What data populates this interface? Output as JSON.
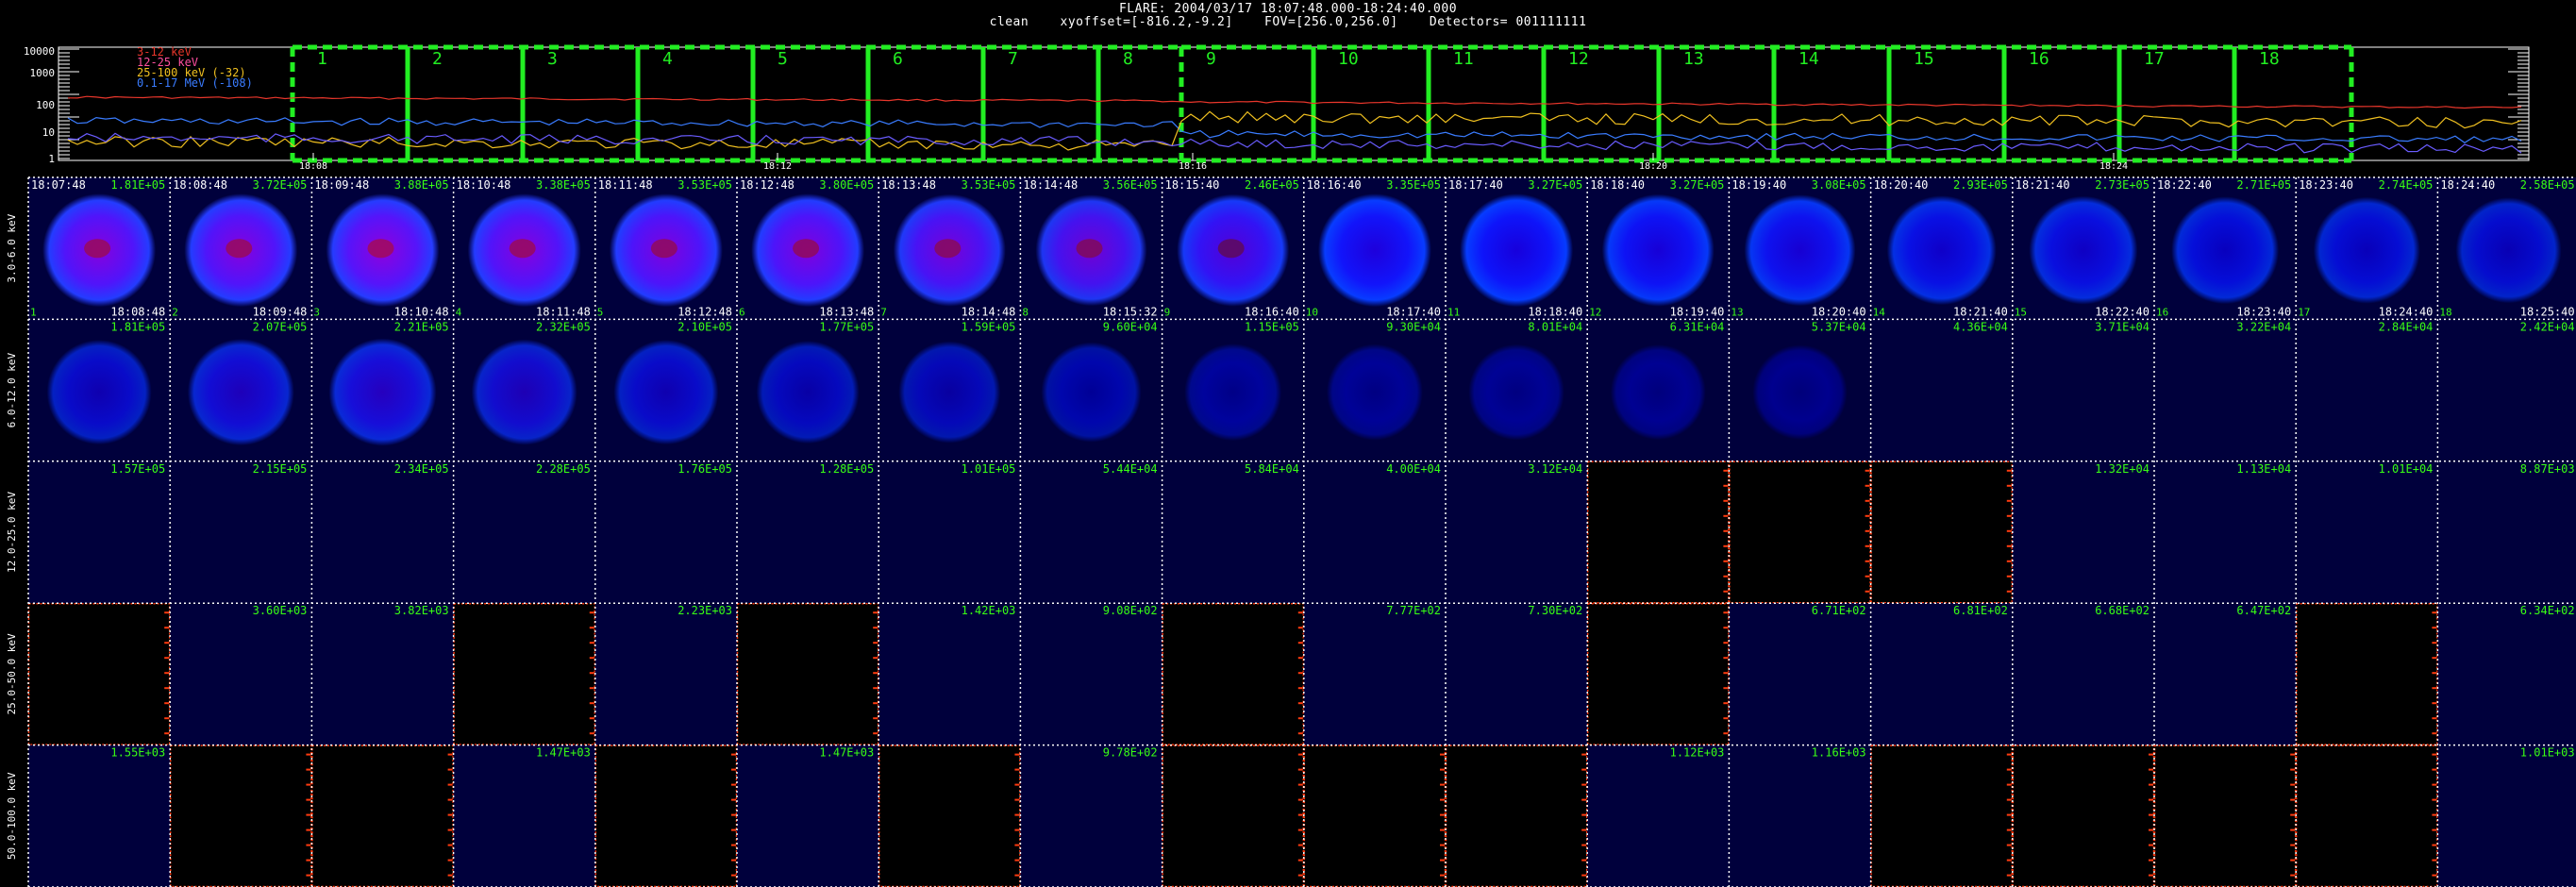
{
  "header": {
    "line1": "FLARE: 2004/03/17 18:07:48.000-18:24:40.000",
    "line2": "clean    xyoffset=[-816.2,-9.2]    FOV=[256.0,256.0]    Detectors= 001111111"
  },
  "lightcurve": {
    "y_ticks": [
      "10000",
      "1000",
      "100",
      "10",
      "1"
    ],
    "legend": [
      {
        "label": "3-12 keV",
        "color": "#e8362b"
      },
      {
        "label": "12-25 keV",
        "color": "#ff4fa0"
      },
      {
        "label": "25-100 keV (-32)",
        "color": "#f0c020"
      },
      {
        "label": "0.1-17 MeV (-108)",
        "color": "#3a7cff"
      }
    ],
    "time_ticks": [
      "18:08",
      "18:12",
      "18:16",
      "18:20",
      "18:24"
    ],
    "interval_numbers": [
      "1",
      "2",
      "3",
      "4",
      "5",
      "6",
      "7",
      "8",
      "9",
      "10",
      "11",
      "12",
      "13",
      "14",
      "15",
      "16",
      "17",
      "18"
    ]
  },
  "rows": [
    {
      "label": "3.0-6.0 keV",
      "cells": [
        {
          "start": "18:07:48",
          "end": "18:08:48",
          "value": "1.81E+05",
          "num": "1",
          "bright": 1.0,
          "red": 0.9,
          "empty": false
        },
        {
          "start": "18:08:48",
          "end": "18:09:48",
          "value": "3.72E+05",
          "num": "2",
          "bright": 1.0,
          "red": 0.9,
          "empty": false
        },
        {
          "start": "18:09:48",
          "end": "18:10:48",
          "value": "3.88E+05",
          "num": "3",
          "bright": 1.0,
          "red": 0.95,
          "empty": false
        },
        {
          "start": "18:10:48",
          "end": "18:11:48",
          "value": "3.38E+05",
          "num": "4",
          "bright": 1.0,
          "red": 0.9,
          "empty": false
        },
        {
          "start": "18:11:48",
          "end": "18:12:48",
          "value": "3.53E+05",
          "num": "5",
          "bright": 1.0,
          "red": 0.85,
          "empty": false
        },
        {
          "start": "18:12:48",
          "end": "18:13:48",
          "value": "3.80E+05",
          "num": "6",
          "bright": 1.0,
          "red": 0.85,
          "empty": false
        },
        {
          "start": "18:13:48",
          "end": "18:14:48",
          "value": "3.53E+05",
          "num": "7",
          "bright": 0.95,
          "red": 0.8,
          "empty": false
        },
        {
          "start": "18:14:48",
          "end": "18:15:32",
          "value": "3.56E+05",
          "num": "8",
          "bright": 0.9,
          "red": 0.75,
          "empty": false
        },
        {
          "start": "18:15:40",
          "end": "18:16:40",
          "value": "2.46E+05",
          "num": "9",
          "bright": 0.95,
          "red": 0.55,
          "empty": false
        },
        {
          "start": "18:16:40",
          "end": "18:17:40",
          "value": "3.35E+05",
          "num": "10",
          "bright": 1.0,
          "red": 0.2,
          "empty": false
        },
        {
          "start": "18:17:40",
          "end": "18:18:40",
          "value": "3.27E+05",
          "num": "11",
          "bright": 1.0,
          "red": 0.15,
          "empty": false
        },
        {
          "start": "18:18:40",
          "end": "18:19:40",
          "value": "3.27E+05",
          "num": "12",
          "bright": 0.95,
          "red": 0.15,
          "empty": false
        },
        {
          "start": "18:19:40",
          "end": "18:20:40",
          "value": "3.08E+05",
          "num": "13",
          "bright": 0.9,
          "red": 0.15,
          "empty": false
        },
        {
          "start": "18:20:40",
          "end": "18:21:40",
          "value": "2.93E+05",
          "num": "14",
          "bright": 0.8,
          "red": 0.1,
          "empty": false
        },
        {
          "start": "18:21:40",
          "end": "18:22:40",
          "value": "2.73E+05",
          "num": "15",
          "bright": 0.75,
          "red": 0.1,
          "empty": false
        },
        {
          "start": "18:22:40",
          "end": "18:23:40",
          "value": "2.71E+05",
          "num": "16",
          "bright": 0.7,
          "red": 0.05,
          "empty": false
        },
        {
          "start": "18:23:40",
          "end": "18:24:40",
          "value": "2.74E+05",
          "num": "17",
          "bright": 0.65,
          "red": 0.05,
          "empty": false
        },
        {
          "start": "18:24:40",
          "end": "18:25:40",
          "value": "2.58E+05",
          "num": "18",
          "bright": 0.6,
          "red": 0.05,
          "empty": false
        }
      ]
    },
    {
      "label": "6.0-12.0 keV",
      "cells": [
        {
          "value": "1.81E+05",
          "bright": 0.55,
          "red": 0.1,
          "empty": false
        },
        {
          "value": "2.07E+05",
          "bright": 0.65,
          "red": 0.2,
          "empty": false
        },
        {
          "value": "2.21E+05",
          "bright": 0.7,
          "red": 0.25,
          "empty": false
        },
        {
          "value": "2.32E+05",
          "bright": 0.6,
          "red": 0.2,
          "empty": false
        },
        {
          "value": "2.10E+05",
          "bright": 0.55,
          "red": 0.1,
          "empty": false
        },
        {
          "value": "1.77E+05",
          "bright": 0.45,
          "red": 0.05,
          "empty": false
        },
        {
          "value": "1.59E+05",
          "bright": 0.4,
          "red": 0.05,
          "empty": false
        },
        {
          "value": "9.60E+04",
          "bright": 0.3,
          "red": 0.0,
          "empty": false
        },
        {
          "value": "1.15E+05",
          "bright": 0.15,
          "red": 0.0,
          "empty": false
        },
        {
          "value": "9.30E+04",
          "bright": 0.1,
          "red": 0.0,
          "empty": false
        },
        {
          "value": "8.01E+04",
          "bright": 0.08,
          "red": 0.0,
          "empty": false
        },
        {
          "value": "6.31E+04",
          "bright": 0.05,
          "red": 0.0,
          "empty": false
        },
        {
          "value": "5.37E+04",
          "bright": 0.02,
          "red": 0.0,
          "empty": false
        },
        {
          "value": "4.36E+04",
          "bright": 0.0,
          "red": 0.0,
          "empty": false
        },
        {
          "value": "3.71E+04",
          "bright": 0.0,
          "red": 0.0,
          "empty": false
        },
        {
          "value": "3.22E+04",
          "bright": 0.0,
          "red": 0.0,
          "empty": false
        },
        {
          "value": "2.84E+04",
          "bright": 0.0,
          "red": 0.0,
          "empty": false
        },
        {
          "value": "2.42E+04",
          "bright": 0.0,
          "red": 0.0,
          "empty": false
        }
      ]
    },
    {
      "label": "12.0-25.0 keV",
      "cells": [
        {
          "value": "1.57E+05",
          "bright": 0,
          "red": 0,
          "empty": false
        },
        {
          "value": "2.15E+05",
          "bright": 0,
          "red": 0,
          "empty": false
        },
        {
          "value": "2.34E+05",
          "bright": 0,
          "red": 0,
          "empty": false
        },
        {
          "value": "2.28E+05",
          "bright": 0,
          "red": 0,
          "empty": false
        },
        {
          "value": "1.76E+05",
          "bright": 0,
          "red": 0,
          "empty": false
        },
        {
          "value": "1.28E+05",
          "bright": 0,
          "red": 0,
          "empty": false
        },
        {
          "value": "1.01E+05",
          "bright": 0,
          "red": 0,
          "empty": false
        },
        {
          "value": "5.44E+04",
          "bright": 0,
          "red": 0,
          "empty": false
        },
        {
          "value": "5.84E+04",
          "bright": 0,
          "red": 0,
          "empty": false
        },
        {
          "value": "4.00E+04",
          "bright": 0,
          "red": 0,
          "empty": false
        },
        {
          "value": "3.12E+04",
          "bright": 0,
          "red": 0,
          "empty": false
        },
        {
          "value": "",
          "bright": 0,
          "red": 0,
          "empty": true
        },
        {
          "value": "",
          "bright": 0,
          "red": 0,
          "empty": true
        },
        {
          "value": "",
          "bright": 0,
          "red": 0,
          "empty": true
        },
        {
          "value": "1.32E+04",
          "bright": 0,
          "red": 0,
          "empty": false
        },
        {
          "value": "1.13E+04",
          "bright": 0,
          "red": 0,
          "empty": false
        },
        {
          "value": "1.01E+04",
          "bright": 0,
          "red": 0,
          "empty": false
        },
        {
          "value": "8.87E+03",
          "bright": 0,
          "red": 0,
          "empty": false
        }
      ]
    },
    {
      "label": "25.0-50.0 keV",
      "cells": [
        {
          "value": "",
          "bright": 0,
          "red": 0,
          "empty": true
        },
        {
          "value": "3.60E+03",
          "bright": 0,
          "red": 0,
          "empty": false
        },
        {
          "value": "3.82E+03",
          "bright": 0,
          "red": 0,
          "empty": false
        },
        {
          "value": "",
          "bright": 0,
          "red": 0,
          "empty": true
        },
        {
          "value": "2.23E+03",
          "bright": 0,
          "red": 0,
          "empty": false
        },
        {
          "value": "",
          "bright": 0,
          "red": 0,
          "empty": true
        },
        {
          "value": "1.42E+03",
          "bright": 0,
          "red": 0,
          "empty": false
        },
        {
          "value": "9.08E+02",
          "bright": 0,
          "red": 0,
          "empty": false
        },
        {
          "value": "",
          "bright": 0,
          "red": 0,
          "empty": true
        },
        {
          "value": "7.77E+02",
          "bright": 0,
          "red": 0,
          "empty": false
        },
        {
          "value": "7.30E+02",
          "bright": 0,
          "red": 0,
          "empty": false
        },
        {
          "value": "",
          "bright": 0,
          "red": 0,
          "empty": true
        },
        {
          "value": "6.71E+02",
          "bright": 0,
          "red": 0,
          "empty": false
        },
        {
          "value": "6.81E+02",
          "bright": 0,
          "red": 0,
          "empty": false
        },
        {
          "value": "6.68E+02",
          "bright": 0,
          "red": 0,
          "empty": false
        },
        {
          "value": "6.47E+02",
          "bright": 0,
          "red": 0,
          "empty": false
        },
        {
          "value": "",
          "bright": 0,
          "red": 0,
          "empty": true
        },
        {
          "value": "6.34E+02",
          "bright": 0,
          "red": 0,
          "empty": false
        }
      ]
    },
    {
      "label": "50.0-100.0 keV",
      "cells": [
        {
          "value": "1.55E+03",
          "bright": 0,
          "red": 0,
          "empty": false
        },
        {
          "value": "",
          "bright": 0,
          "red": 0,
          "empty": true
        },
        {
          "value": "",
          "bright": 0,
          "red": 0,
          "empty": true
        },
        {
          "value": "1.47E+03",
          "bright": 0,
          "red": 0,
          "empty": false
        },
        {
          "value": "",
          "bright": 0,
          "red": 0,
          "empty": true
        },
        {
          "value": "1.47E+03",
          "bright": 0,
          "red": 0,
          "empty": false
        },
        {
          "value": "",
          "bright": 0,
          "red": 0,
          "empty": true
        },
        {
          "value": "9.78E+02",
          "bright": 0,
          "red": 0,
          "empty": false
        },
        {
          "value": "",
          "bright": 0,
          "red": 0,
          "empty": true
        },
        {
          "value": "",
          "bright": 0,
          "red": 0,
          "empty": true
        },
        {
          "value": "",
          "bright": 0,
          "red": 0,
          "empty": true
        },
        {
          "value": "1.12E+03",
          "bright": 0,
          "red": 0,
          "empty": false
        },
        {
          "value": "1.16E+03",
          "bright": 0,
          "red": 0,
          "empty": false
        },
        {
          "value": "",
          "bright": 0,
          "red": 0,
          "empty": true
        },
        {
          "value": "",
          "bright": 0,
          "red": 0,
          "empty": true
        },
        {
          "value": "",
          "bright": 0,
          "red": 0,
          "empty": true
        },
        {
          "value": "",
          "bright": 0,
          "red": 0,
          "empty": true
        },
        {
          "value": "1.01E+03",
          "bright": 0,
          "red": 0,
          "empty": false
        }
      ]
    }
  ],
  "colors": {
    "grid_line": "#ffffff",
    "value_text": "#39ff14",
    "interval_box": "#22ee22",
    "empty_border": "#ff3b10",
    "cell_bg": "#00003c"
  }
}
